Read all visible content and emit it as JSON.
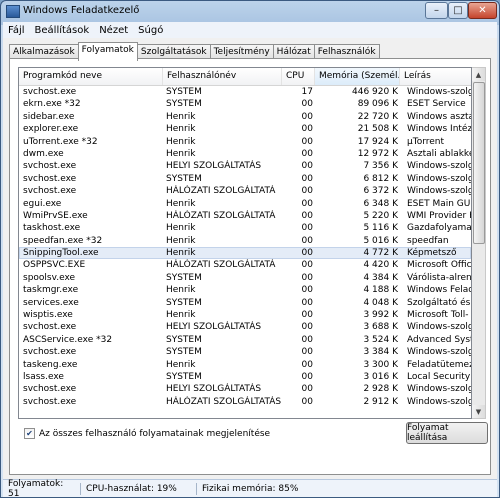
{
  "window": {
    "title": "Windows Feladatkezelő",
    "buttons": {
      "minimize": "–",
      "maximize": "□",
      "close": "✕"
    }
  },
  "menu": [
    "Fájl",
    "Beállítások",
    "Nézet",
    "Súgó"
  ],
  "tabs": [
    "Alkalmazások",
    "Folyamatok",
    "Szolgáltatások",
    "Teljesítmény",
    "Hálózat",
    "Felhasználók"
  ],
  "active_tab": "Folyamatok",
  "columns": [
    "Programkód neve",
    "Felhasználónév",
    "CPU",
    "Memória (Személ...",
    "Leírás"
  ],
  "processes": [
    {
      "name": "svchost.exe",
      "user": "SYSTEM",
      "cpu": "17",
      "mem": "446 920 K",
      "desc": "Windows-szolgáltatás"
    },
    {
      "name": "ekrn.exe *32",
      "user": "SYSTEM",
      "cpu": "00",
      "mem": "89 096 K",
      "desc": "ESET Service"
    },
    {
      "name": "sidebar.exe",
      "user": "Henrik",
      "cpu": "00",
      "mem": "22 720 K",
      "desc": "Windows asztali minial"
    },
    {
      "name": "explorer.exe",
      "user": "Henrik",
      "cpu": "00",
      "mem": "21 508 K",
      "desc": "Windows Intéző"
    },
    {
      "name": "uTorrent.exe *32",
      "user": "Henrik",
      "cpu": "00",
      "mem": "17 924 K",
      "desc": "µTorrent"
    },
    {
      "name": "dwm.exe",
      "user": "Henrik",
      "cpu": "00",
      "mem": "12 972 K",
      "desc": "Asztali ablakkezelő"
    },
    {
      "name": "svchost.exe",
      "user": "HELYI SZOLGÁLTATÁS",
      "cpu": "00",
      "mem": "7 356 K",
      "desc": "Windows-szolgáltatás"
    },
    {
      "name": "svchost.exe",
      "user": "SYSTEM",
      "cpu": "00",
      "mem": "6 812 K",
      "desc": "Windows-szolgáltatás"
    },
    {
      "name": "svchost.exe",
      "user": "HÁLÓZATI SZOLGÁLTATÁ",
      "cpu": "00",
      "mem": "6 372 K",
      "desc": "Windows-szolgáltatás"
    },
    {
      "name": "egui.exe",
      "user": "Henrik",
      "cpu": "00",
      "mem": "6 348 K",
      "desc": "ESET Main GUI"
    },
    {
      "name": "WmiPrvSE.exe",
      "user": "HÁLÓZATI SZOLGÁLTATÁ",
      "cpu": "00",
      "mem": "5 220 K",
      "desc": "WMI Provider Host"
    },
    {
      "name": "taskhost.exe",
      "user": "Henrik",
      "cpu": "00",
      "mem": "5 116 K",
      "desc": "Gazdafolyamat Windo"
    },
    {
      "name": "speedfan.exe *32",
      "user": "Henrik",
      "cpu": "00",
      "mem": "5 016 K",
      "desc": "speedfan"
    },
    {
      "name": "SnippingTool.exe",
      "user": "Henrik",
      "cpu": "00",
      "mem": "4 772 K",
      "desc": "Képmetsző",
      "selected": true
    },
    {
      "name": "OSPPSVC.EXE",
      "user": "HÁLÓZATI SZOLGÁLTATÁ",
      "cpu": "00",
      "mem": "4 420 K",
      "desc": "Microsoft Office Softw"
    },
    {
      "name": "spoolsv.exe",
      "user": "SYSTEM",
      "cpu": "00",
      "mem": "4 384 K",
      "desc": "Várólista-alrendszer ka"
    },
    {
      "name": "taskmgr.exe",
      "user": "Henrik",
      "cpu": "00",
      "mem": "4 188 K",
      "desc": "Windows Feladatkezel"
    },
    {
      "name": "services.exe",
      "user": "SYSTEM",
      "cpu": "00",
      "mem": "4 048 K",
      "desc": "Szolgáltató és vezérlő"
    },
    {
      "name": "wisptis.exe",
      "user": "Henrik",
      "cpu": "00",
      "mem": "3 992 K",
      "desc": "Microsoft Toll- és érint"
    },
    {
      "name": "svchost.exe",
      "user": "HELYI SZOLGÁLTATÁS",
      "cpu": "00",
      "mem": "3 688 K",
      "desc": "Windows-szolgáltatás"
    },
    {
      "name": "ASCService.exe *32",
      "user": "SYSTEM",
      "cpu": "00",
      "mem": "3 524 K",
      "desc": "Advanced SystemCare"
    },
    {
      "name": "svchost.exe",
      "user": "SYSTEM",
      "cpu": "00",
      "mem": "3 384 K",
      "desc": "Windows-szolgáltatás"
    },
    {
      "name": "taskeng.exe",
      "user": "Henrik",
      "cpu": "00",
      "mem": "3 300 K",
      "desc": "Feladatütemező motor"
    },
    {
      "name": "lsass.exe",
      "user": "SYSTEM",
      "cpu": "00",
      "mem": "3 016 K",
      "desc": "Local Security Authorit"
    },
    {
      "name": "svchost.exe",
      "user": "HELYI SZOLGÁLTATÁS",
      "cpu": "00",
      "mem": "2 928 K",
      "desc": "Windows-szolgáltatás"
    },
    {
      "name": "svchost.exe",
      "user": "HÁLÓZATI SZOLGÁLTATÁS",
      "cpu": "00",
      "mem": "2 912 K",
      "desc": "Windows-szolgáltatás"
    }
  ],
  "show_all_label": "Az összes felhasználó folyamatainak megjelenítése",
  "show_all_checked": true,
  "end_process_label": "Folyamat leállítása",
  "status": {
    "processes": "Folyamatok: 51",
    "cpu": "CPU-használat: 19%",
    "memory": "Fizikai memória: 85%"
  }
}
